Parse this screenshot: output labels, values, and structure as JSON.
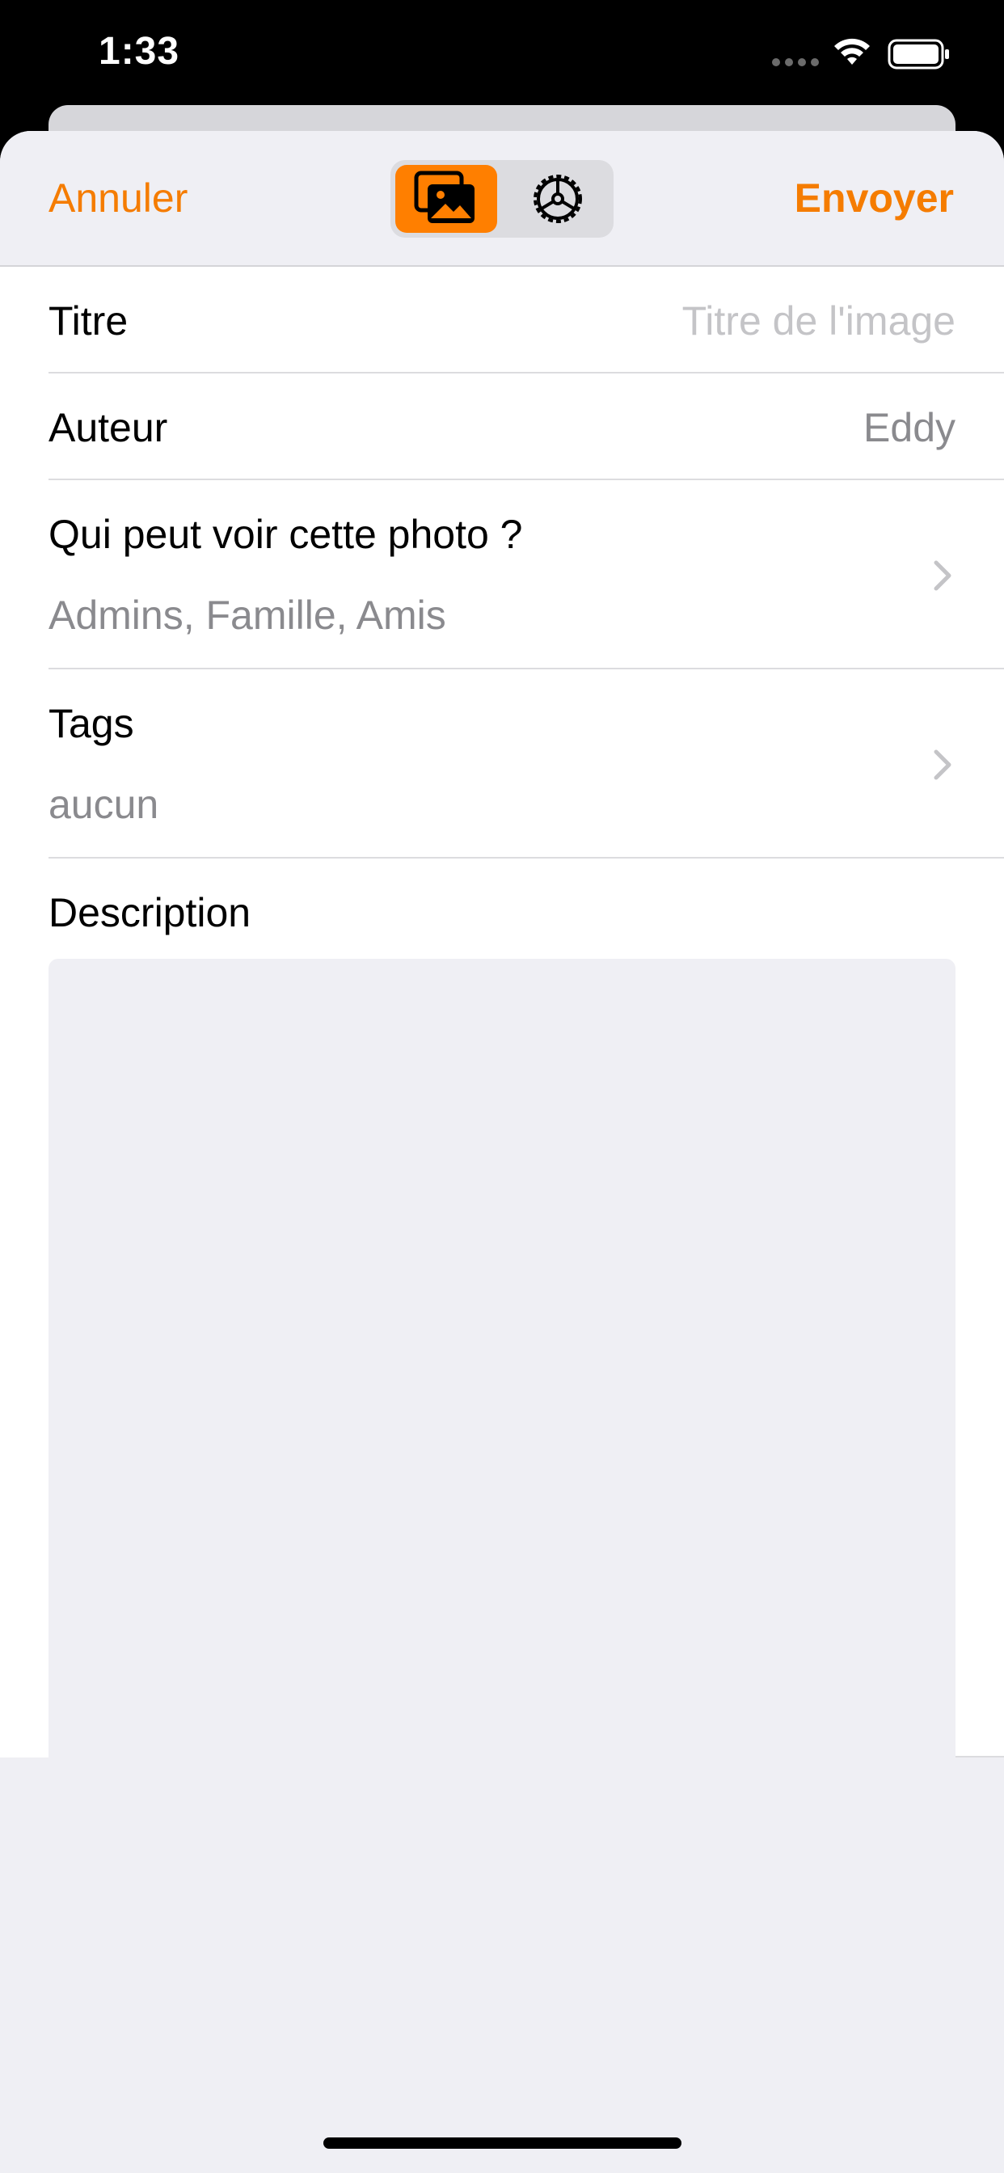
{
  "status_bar": {
    "time": "1:33",
    "icons": [
      "signal-dots-icon",
      "wifi-icon",
      "battery-icon"
    ]
  },
  "nav": {
    "cancel_label": "Annuler",
    "send_label": "Envoyer",
    "segments": [
      {
        "name": "images-icon",
        "selected": true
      },
      {
        "name": "settings-gear-icon",
        "selected": false
      }
    ]
  },
  "form": {
    "title_label": "Titre",
    "title_placeholder": "Titre de l'image",
    "author_label": "Auteur",
    "author_value": "Eddy",
    "privacy_label": "Qui peut voir cette photo ?",
    "privacy_value": "Admins, Famille, Amis",
    "tags_label": "Tags",
    "tags_value": "aucun",
    "description_label": "Description",
    "description_value": ""
  },
  "colors": {
    "accent": "#ff7f00",
    "accent_text": "#f57c00",
    "background": "#efeff4",
    "secondary_text": "#8a8a8e"
  }
}
